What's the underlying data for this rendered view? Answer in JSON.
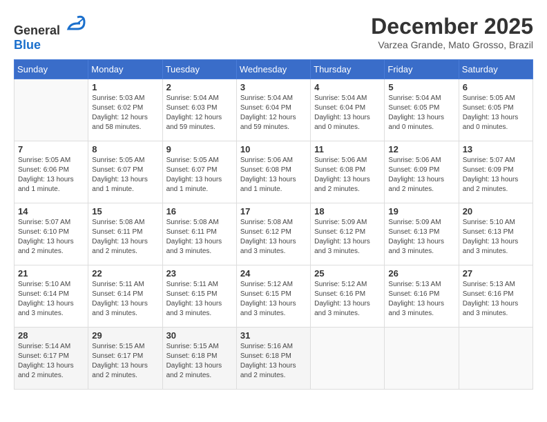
{
  "header": {
    "logo": {
      "text_general": "General",
      "text_blue": "Blue"
    },
    "title": "December 2025",
    "location": "Varzea Grande, Mato Grosso, Brazil"
  },
  "calendar": {
    "days_of_week": [
      "Sunday",
      "Monday",
      "Tuesday",
      "Wednesday",
      "Thursday",
      "Friday",
      "Saturday"
    ],
    "weeks": [
      [
        {
          "day": "",
          "info": ""
        },
        {
          "day": "1",
          "info": "Sunrise: 5:03 AM\nSunset: 6:02 PM\nDaylight: 12 hours\nand 58 minutes."
        },
        {
          "day": "2",
          "info": "Sunrise: 5:04 AM\nSunset: 6:03 PM\nDaylight: 12 hours\nand 59 minutes."
        },
        {
          "day": "3",
          "info": "Sunrise: 5:04 AM\nSunset: 6:04 PM\nDaylight: 12 hours\nand 59 minutes."
        },
        {
          "day": "4",
          "info": "Sunrise: 5:04 AM\nSunset: 6:04 PM\nDaylight: 13 hours\nand 0 minutes."
        },
        {
          "day": "5",
          "info": "Sunrise: 5:04 AM\nSunset: 6:05 PM\nDaylight: 13 hours\nand 0 minutes."
        },
        {
          "day": "6",
          "info": "Sunrise: 5:05 AM\nSunset: 6:05 PM\nDaylight: 13 hours\nand 0 minutes."
        }
      ],
      [
        {
          "day": "7",
          "info": "Sunrise: 5:05 AM\nSunset: 6:06 PM\nDaylight: 13 hours\nand 1 minute."
        },
        {
          "day": "8",
          "info": "Sunrise: 5:05 AM\nSunset: 6:07 PM\nDaylight: 13 hours\nand 1 minute."
        },
        {
          "day": "9",
          "info": "Sunrise: 5:05 AM\nSunset: 6:07 PM\nDaylight: 13 hours\nand 1 minute."
        },
        {
          "day": "10",
          "info": "Sunrise: 5:06 AM\nSunset: 6:08 PM\nDaylight: 13 hours\nand 1 minute."
        },
        {
          "day": "11",
          "info": "Sunrise: 5:06 AM\nSunset: 6:08 PM\nDaylight: 13 hours\nand 2 minutes."
        },
        {
          "day": "12",
          "info": "Sunrise: 5:06 AM\nSunset: 6:09 PM\nDaylight: 13 hours\nand 2 minutes."
        },
        {
          "day": "13",
          "info": "Sunrise: 5:07 AM\nSunset: 6:09 PM\nDaylight: 13 hours\nand 2 minutes."
        }
      ],
      [
        {
          "day": "14",
          "info": "Sunrise: 5:07 AM\nSunset: 6:10 PM\nDaylight: 13 hours\nand 2 minutes."
        },
        {
          "day": "15",
          "info": "Sunrise: 5:08 AM\nSunset: 6:11 PM\nDaylight: 13 hours\nand 2 minutes."
        },
        {
          "day": "16",
          "info": "Sunrise: 5:08 AM\nSunset: 6:11 PM\nDaylight: 13 hours\nand 3 minutes."
        },
        {
          "day": "17",
          "info": "Sunrise: 5:08 AM\nSunset: 6:12 PM\nDaylight: 13 hours\nand 3 minutes."
        },
        {
          "day": "18",
          "info": "Sunrise: 5:09 AM\nSunset: 6:12 PM\nDaylight: 13 hours\nand 3 minutes."
        },
        {
          "day": "19",
          "info": "Sunrise: 5:09 AM\nSunset: 6:13 PM\nDaylight: 13 hours\nand 3 minutes."
        },
        {
          "day": "20",
          "info": "Sunrise: 5:10 AM\nSunset: 6:13 PM\nDaylight: 13 hours\nand 3 minutes."
        }
      ],
      [
        {
          "day": "21",
          "info": "Sunrise: 5:10 AM\nSunset: 6:14 PM\nDaylight: 13 hours\nand 3 minutes."
        },
        {
          "day": "22",
          "info": "Sunrise: 5:11 AM\nSunset: 6:14 PM\nDaylight: 13 hours\nand 3 minutes."
        },
        {
          "day": "23",
          "info": "Sunrise: 5:11 AM\nSunset: 6:15 PM\nDaylight: 13 hours\nand 3 minutes."
        },
        {
          "day": "24",
          "info": "Sunrise: 5:12 AM\nSunset: 6:15 PM\nDaylight: 13 hours\nand 3 minutes."
        },
        {
          "day": "25",
          "info": "Sunrise: 5:12 AM\nSunset: 6:16 PM\nDaylight: 13 hours\nand 3 minutes."
        },
        {
          "day": "26",
          "info": "Sunrise: 5:13 AM\nSunset: 6:16 PM\nDaylight: 13 hours\nand 3 minutes."
        },
        {
          "day": "27",
          "info": "Sunrise: 5:13 AM\nSunset: 6:16 PM\nDaylight: 13 hours\nand 3 minutes."
        }
      ],
      [
        {
          "day": "28",
          "info": "Sunrise: 5:14 AM\nSunset: 6:17 PM\nDaylight: 13 hours\nand 2 minutes."
        },
        {
          "day": "29",
          "info": "Sunrise: 5:15 AM\nSunset: 6:17 PM\nDaylight: 13 hours\nand 2 minutes."
        },
        {
          "day": "30",
          "info": "Sunrise: 5:15 AM\nSunset: 6:18 PM\nDaylight: 13 hours\nand 2 minutes."
        },
        {
          "day": "31",
          "info": "Sunrise: 5:16 AM\nSunset: 6:18 PM\nDaylight: 13 hours\nand 2 minutes."
        },
        {
          "day": "",
          "info": ""
        },
        {
          "day": "",
          "info": ""
        },
        {
          "day": "",
          "info": ""
        }
      ]
    ]
  }
}
